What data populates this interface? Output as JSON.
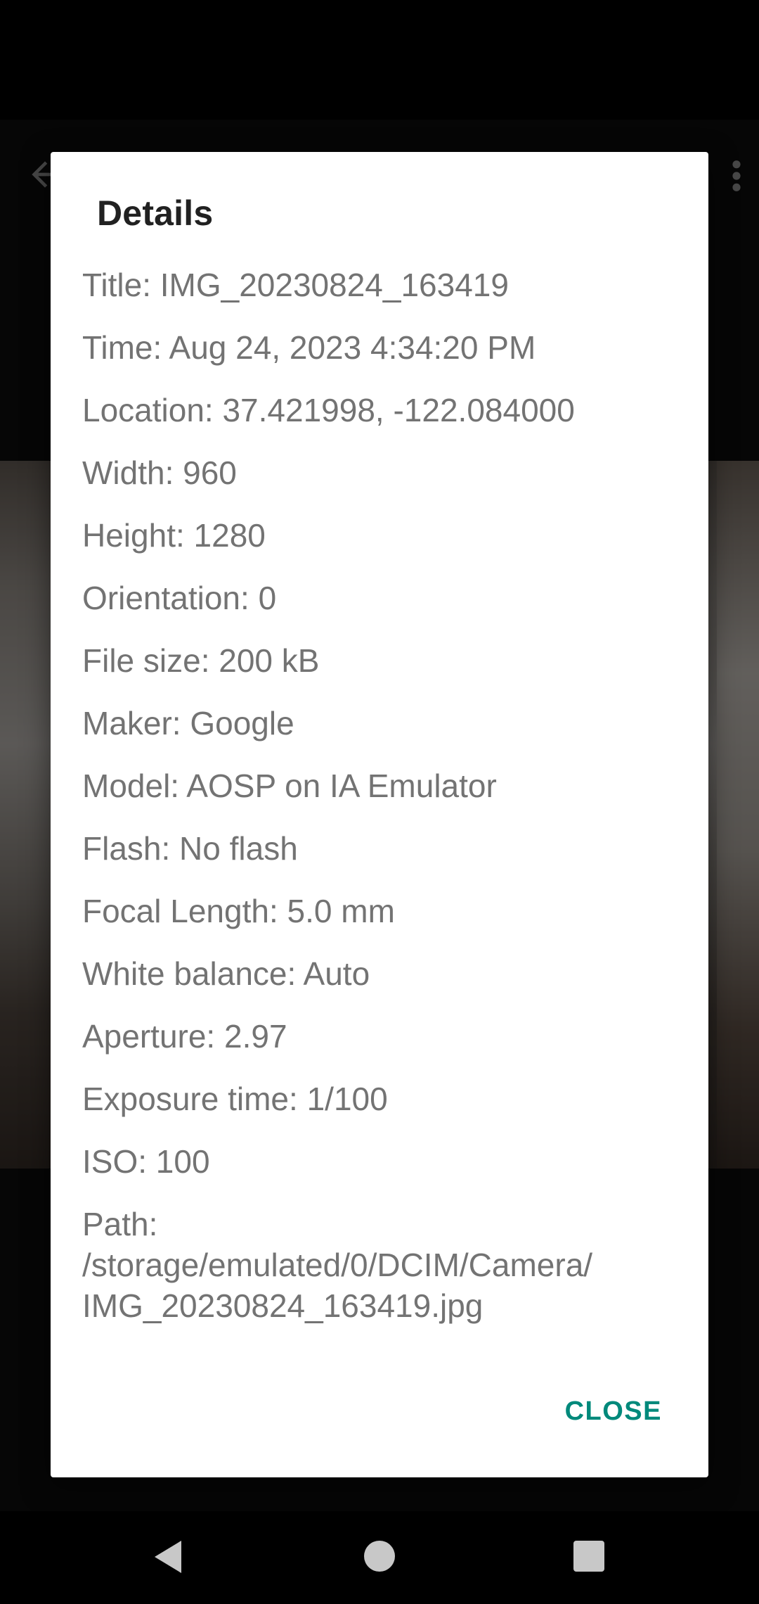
{
  "dialog": {
    "title": "Details",
    "details": [
      "Title: IMG_20230824_163419",
      "Time: Aug 24, 2023 4:34:20 PM",
      "Location: 37.421998, -122.084000",
      "Width: 960",
      "Height: 1280",
      "Orientation: 0",
      "File size: 200 kB",
      "Maker: Google",
      "Model: AOSP on IA Emulator",
      "Flash: No flash",
      "Focal Length: 5.0 mm",
      "White balance: Auto",
      "Aperture: 2.97",
      "Exposure time: 1/100",
      "ISO: 100",
      "Path:\n/storage/emulated/0/DCIM/Camera/\nIMG_20230824_163419.jpg"
    ],
    "close_label": "CLOSE"
  },
  "colors": {
    "accent": "#00897b",
    "detail_text": "#737373",
    "title_text": "#212121"
  },
  "icons": {
    "underlay_back": "arrow-back-icon",
    "underlay_more": "more-vert-icon",
    "nav_back": "triangle-back-icon",
    "nav_home": "circle-home-icon",
    "nav_recents": "square-recents-icon"
  }
}
